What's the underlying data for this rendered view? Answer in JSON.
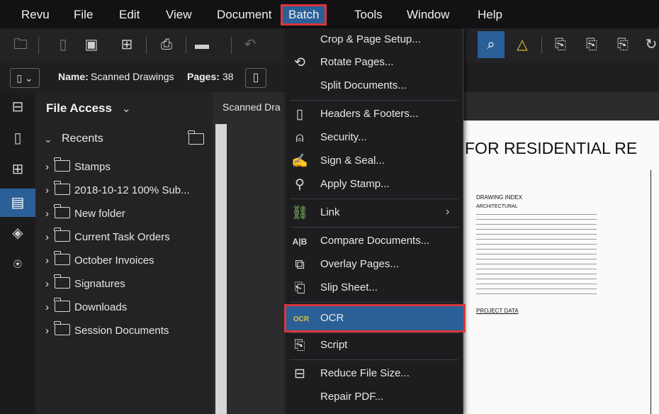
{
  "menubar": {
    "items": [
      "Revu",
      "File",
      "Edit",
      "View",
      "Document",
      "Batch",
      "Tools",
      "Window",
      "Help"
    ]
  },
  "docbar": {
    "name_label": "Name:",
    "name_value": "Scanned Drawings",
    "pages_label": "Pages:",
    "pages_value": "38"
  },
  "file_access": {
    "title": "File Access",
    "recents_label": "Recents",
    "folders": [
      "Stamps",
      "2018-10-12 100% Sub...",
      "New folder",
      "Current Task Orders",
      "October Invoices",
      "Signatures",
      "Downloads",
      "Session Documents"
    ]
  },
  "doc_tab": {
    "label": "Scanned Dra"
  },
  "batch_menu": {
    "items": [
      "Crop & Page Setup...",
      "Rotate Pages...",
      "Split Documents...",
      "Headers & Footers...",
      "Security...",
      "Sign & Seal...",
      "Apply Stamp...",
      "Link",
      "Compare Documents...",
      "Overlay Pages...",
      "Slip Sheet...",
      "OCR",
      "Script",
      "Reduce File Size...",
      "Repair PDF..."
    ],
    "ocr_icon_text": "OCR",
    "compare_icon_text": "A|B"
  },
  "page": {
    "heading": "FOR RESIDENTIAL RE",
    "index_title": "DRAWING INDEX",
    "section": "ARCHITECTURAL",
    "project_data": "PROJECT DATA"
  },
  "colors": {
    "accent": "#2b5f97",
    "highlight": "#d9373b"
  }
}
